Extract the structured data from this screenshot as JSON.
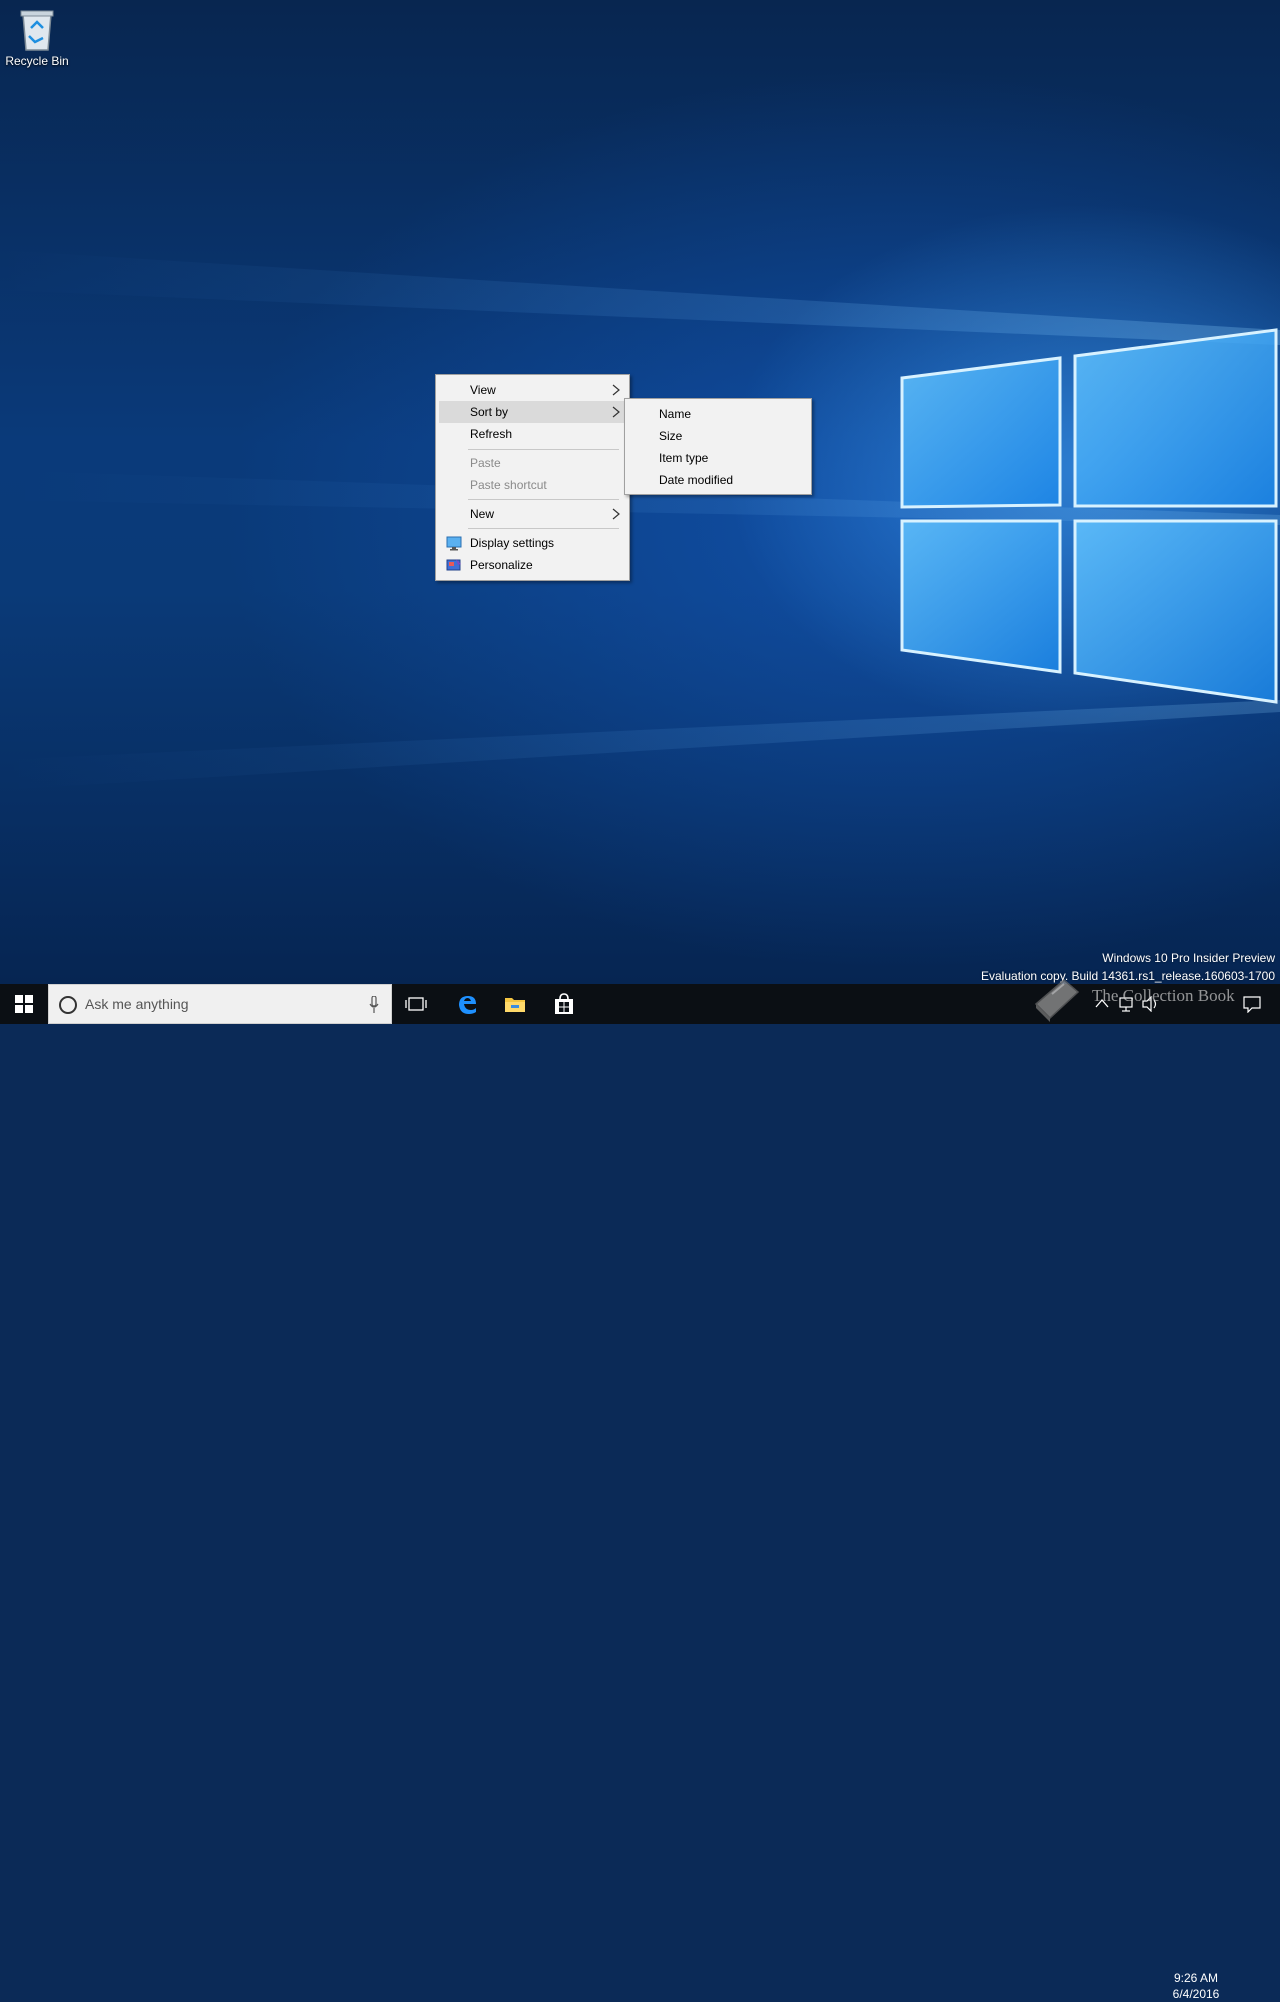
{
  "desktop": {
    "icons": [
      {
        "label": "Recycle Bin",
        "icon": "recycle-bin-icon"
      }
    ]
  },
  "context_menu": {
    "items": [
      {
        "label": "View",
        "has_submenu": true
      },
      {
        "label": "Sort by",
        "has_submenu": true,
        "highlighted": true
      },
      {
        "label": "Refresh"
      },
      {
        "label": "Paste",
        "disabled": true
      },
      {
        "label": "Paste shortcut",
        "disabled": true
      },
      {
        "label": "New",
        "has_submenu": true
      },
      {
        "label": "Display settings",
        "icon": "display-settings-icon"
      },
      {
        "label": "Personalize",
        "icon": "personalize-icon"
      }
    ]
  },
  "sort_submenu": {
    "items": [
      {
        "label": "Name"
      },
      {
        "label": "Size"
      },
      {
        "label": "Item type"
      },
      {
        "label": "Date modified"
      }
    ]
  },
  "watermark": {
    "line1": "Windows 10 Pro Insider Preview",
    "line2": "Evaluation copy. Build 14361.rs1_release.160603-1700"
  },
  "taskbar": {
    "search_placeholder": "Ask me anything",
    "pinned": [
      "task-view-icon",
      "edge-icon",
      "file-explorer-icon",
      "store-icon"
    ],
    "tray_icons": [
      "chevron-up-icon",
      "network-icon",
      "volume-icon",
      "action-center-icon"
    ],
    "clock_time": "9:26 AM",
    "clock_date": "6/4/2016"
  },
  "overlay_watermark": {
    "text": "The Collection Book"
  },
  "colors": {
    "accent": "#0078d7",
    "taskbar_bg": "#0b0f14",
    "menu_bg": "#f2f2f2",
    "menu_highlight": "#dadada"
  }
}
